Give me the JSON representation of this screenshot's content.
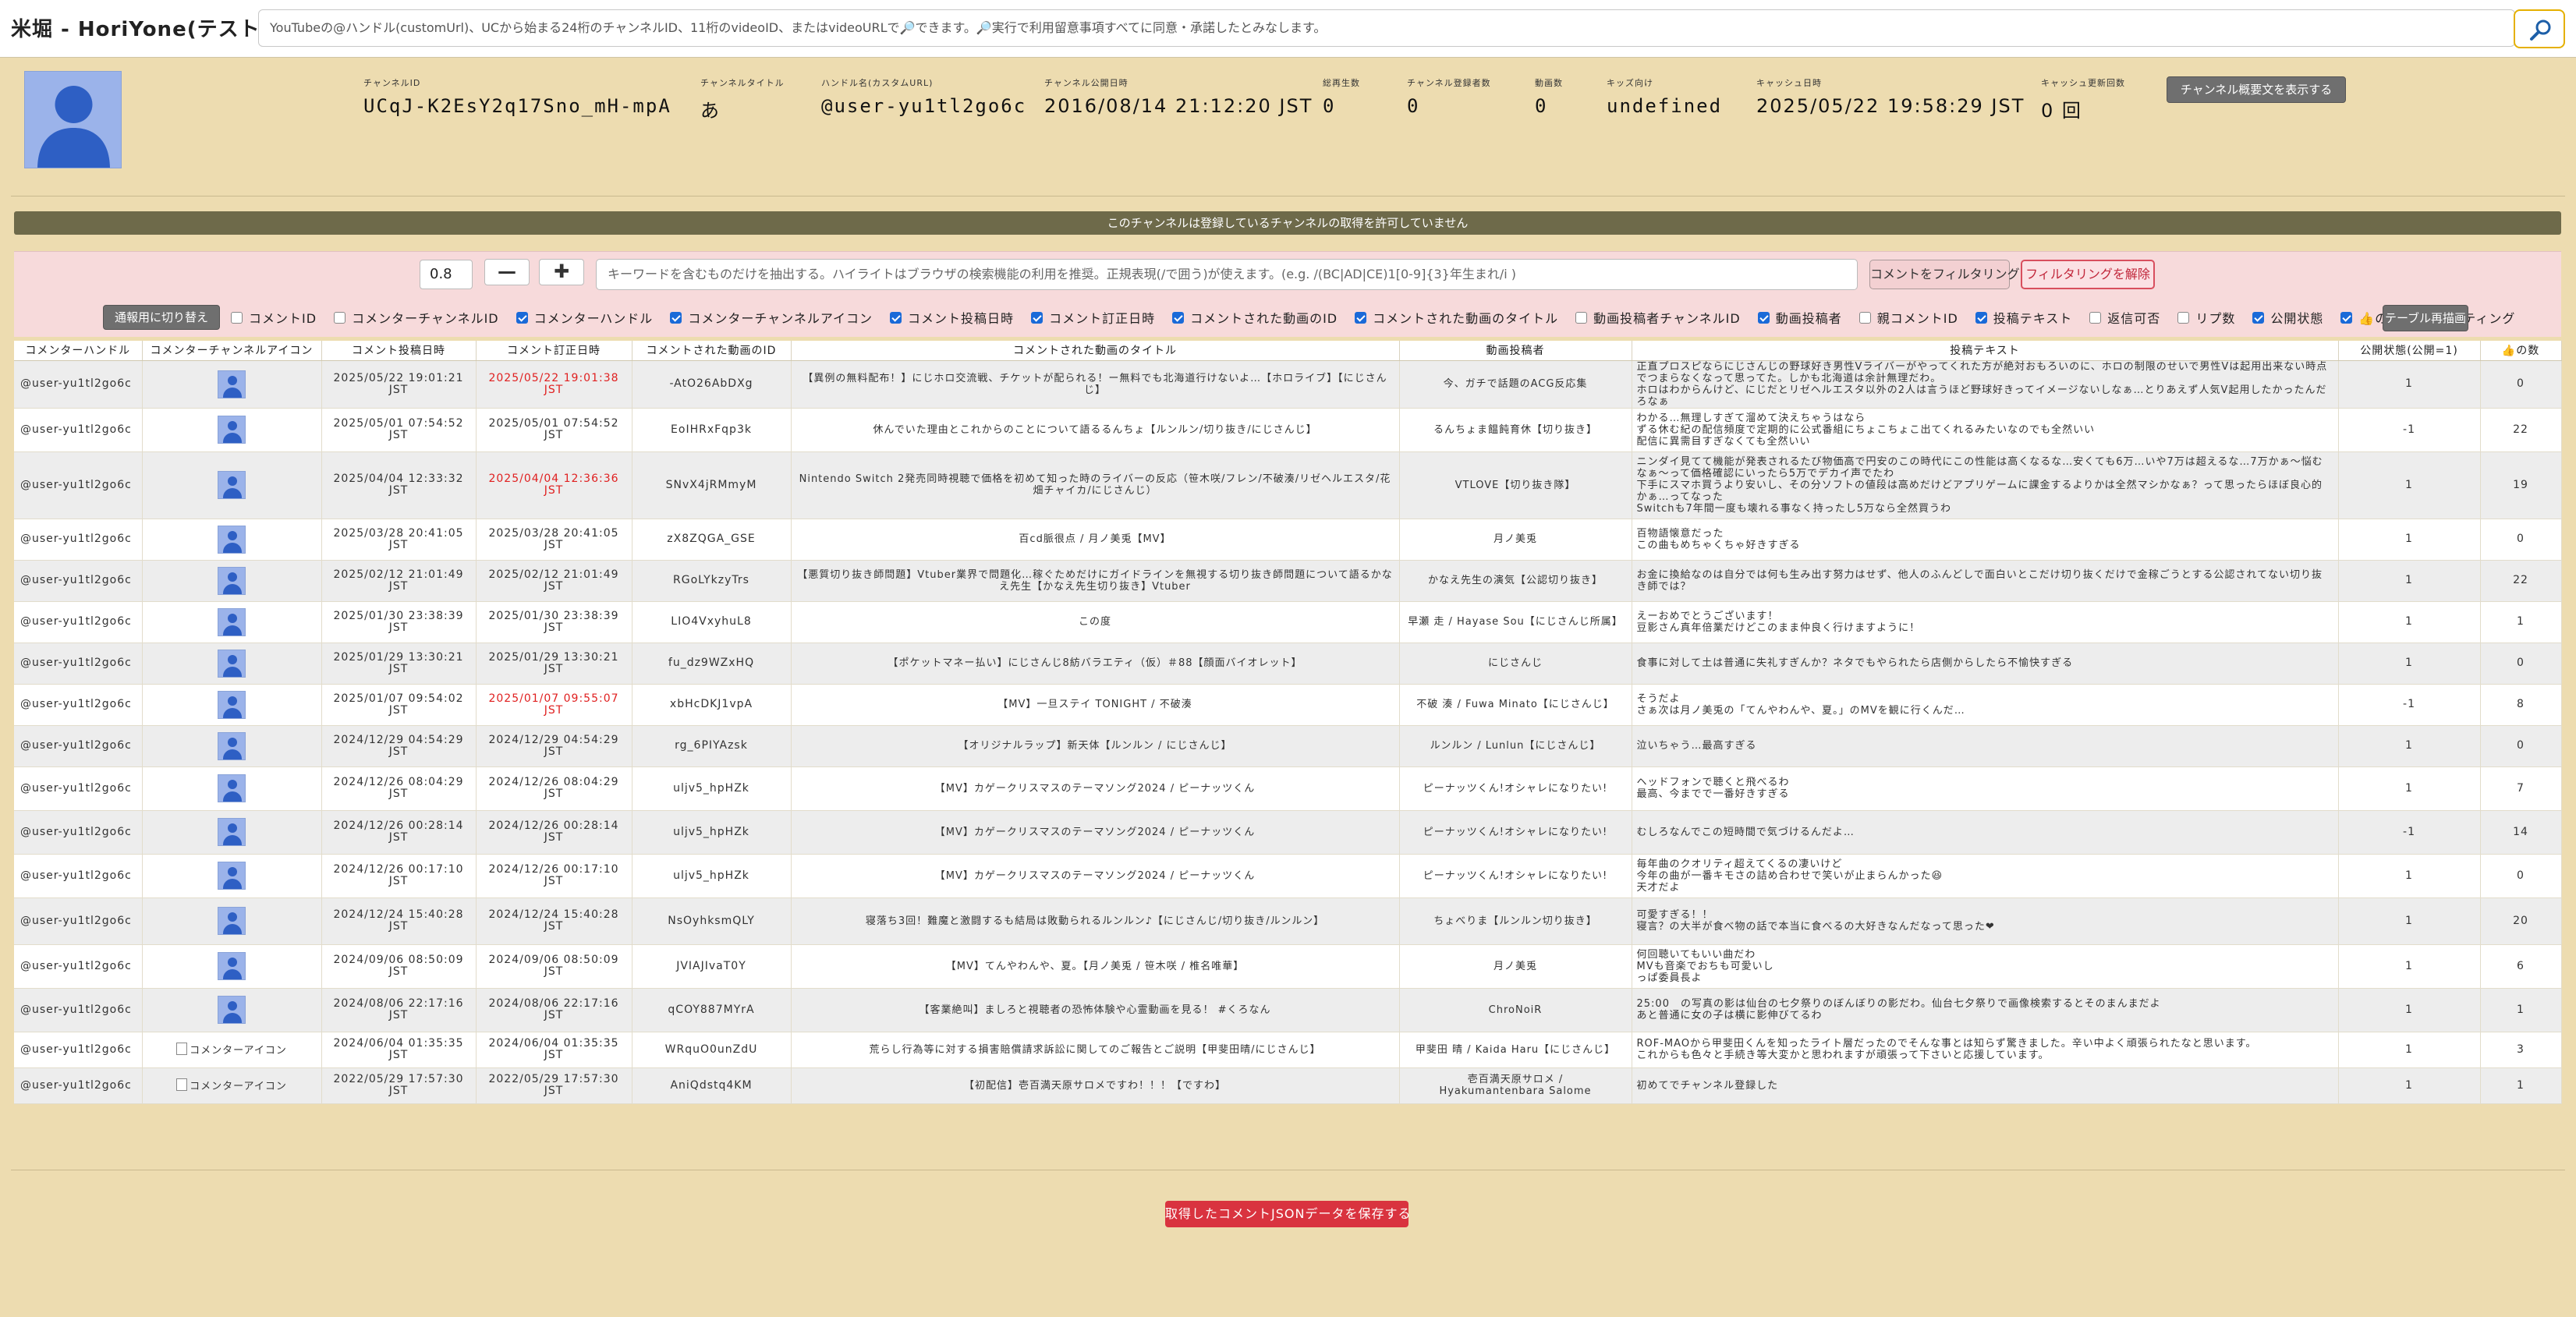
{
  "app": {
    "title": "米堀 - HoriYone(テスト中)",
    "search_placeholder": "YouTubeの@ハンドル(customUrl)、UCから始まる24桁のチャンネルID、11桁のvideoID、またはvideoURLで🔎できます。🔎実行で利用留意事項すべてに同意・承諾したとみなします。",
    "search_button_icon": "search-icon"
  },
  "channel": {
    "fields": [
      {
        "label": "チャンネルID",
        "value": "UCqJ-K2EsY2q17Sno_mH-mpA"
      },
      {
        "label": "チャンネルタイトル",
        "value": "あ"
      },
      {
        "label": "ハンドル名(カスタムURL)",
        "value": "@user-yu1tl2go6c"
      },
      {
        "label": "チャンネル公開日時",
        "value": "2016/08/14 21:12:20 JST"
      },
      {
        "label": "総再生数",
        "value": "0"
      },
      {
        "label": "チャンネル登録者数",
        "value": "0"
      },
      {
        "label": "動画数",
        "value": "0"
      },
      {
        "label": "キッズ向け",
        "value": "undefined"
      },
      {
        "label": "キャッシュ日時",
        "value": "2025/05/22 19:58:29 JST"
      },
      {
        "label": "キャッシュ更新回数",
        "value": "0 回"
      }
    ],
    "show_description_button": "チャンネル概要文を表示する",
    "notice": "このチャンネルは登録しているチャンネルの取得を許可していません"
  },
  "filter": {
    "threshold_value": "0.8",
    "minus_label": "—",
    "plus_label": "✚",
    "keyword_placeholder": "キーワードを含むものだけを抽出する。ハイライトはブラウザの検索機能の利用を推奨。正規表現(/で囲う)が使えます。(e.g. /(BC|AD|CE)1[0-9]{3}年生まれ/i )",
    "filter_button": "コメントをフィルタリング",
    "unfilter_button": "フィルタリングを解除",
    "toggle_view_button": "通報用に切り替え",
    "redraw_button": "テーブル再描画",
    "columns": [
      {
        "label": "コメントID",
        "checked": false
      },
      {
        "label": "コメンターチャンネルID",
        "checked": false
      },
      {
        "label": "コメンターハンドル",
        "checked": true
      },
      {
        "label": "コメンターチャンネルアイコン",
        "checked": true
      },
      {
        "label": "コメント投稿日時",
        "checked": true
      },
      {
        "label": "コメント訂正日時",
        "checked": true
      },
      {
        "label": "コメントされた動画のID",
        "checked": true
      },
      {
        "label": "コメントされた動画のタイトル",
        "checked": true
      },
      {
        "label": "動画投稿者チャンネルID",
        "checked": false
      },
      {
        "label": "動画投稿者",
        "checked": true
      },
      {
        "label": "親コメントID",
        "checked": false
      },
      {
        "label": "投稿テキスト",
        "checked": true
      },
      {
        "label": "返信可否",
        "checked": false
      },
      {
        "label": "リプ数",
        "checked": false
      },
      {
        "label": "公開状態",
        "checked": true
      },
      {
        "label": "👍の数",
        "checked": true
      },
      {
        "label": "レーティング",
        "checked": false
      }
    ]
  },
  "table": {
    "headers": [
      "コメンターハンドル",
      "コメンターチャンネルアイコン",
      "コメント投稿日時",
      "コメント訂正日時",
      "コメントされた動画のID",
      "コメントされた動画のタイトル",
      "動画投稿者",
      "投稿テキスト",
      "公開状態(公開=1)",
      "👍の数"
    ],
    "rows": [
      {
        "handle": "@user-yu1tl2go6c",
        "icon": "avatar",
        "posted": "2025/05/22 19:01:21\nJST",
        "edited": "2025/05/22 19:01:38\nJST",
        "edited_red": true,
        "video_id": "-AtO26AbDXg",
        "title": "【異例の無料配布！】にじホロ交流戦、チケットが配られる！ー無料でも北海道行けないよ…【ホロライブ】【にじさんじ】",
        "uploader": "今、ガチで話題のACG反応集",
        "text": "正直プロスピならにじさんじの野球好き男性Vライバーがやってくれた方が絶対おもろいのに、ホロの制限のせいで男性Vは起用出来ない時点でつまらなくなって思ってた。しかも北海道は余計無理だわ。\nホロはわからんけど、にじだとリゼヘルエスタ以外の2人は言うほど野球好きってイメージないしなぁ…とりあえず人気V起用したかったんだろなぁ",
        "status": "1",
        "likes": "0",
        "h": 56
      },
      {
        "handle": "@user-yu1tl2go6c",
        "icon": "avatar",
        "posted": "2025/05/01 07:54:52\nJST",
        "edited": "2025/05/01 07:54:52\nJST",
        "edited_red": false,
        "video_id": "EoIHRxFqp3k",
        "title": "休んでいた理由とこれからのことについて語るるんちょ【ルンルン/切り抜き/にじさんじ】",
        "uploader": "るんちょま饂飩育休【切り抜き】",
        "text": "わかる…無理しすぎて溜めて決えちゃうはなら\nずる休む紀の配信頻度で定期的に公式番組にちょこちょこ出てくれるみたいなのでも全然いい\n配信に異需目すぎなくても全然いい",
        "status": "-1",
        "likes": "22",
        "h": 56
      },
      {
        "handle": "@user-yu1tl2go6c",
        "icon": "avatar",
        "posted": "2025/04/04 12:33:32\nJST",
        "edited": "2025/04/04 12:36:36\nJST",
        "edited_red": true,
        "video_id": "SNvX4jRMmyM",
        "title": "Nintendo Switch 2発売同時視聴で価格を初めて知った時のライバーの反応（笹木咲/フレン/不破湊/リゼヘルエスタ/花畑チャイカ/にじさんじ）",
        "uploader": "VTLOVE【切り抜き隊】",
        "text": "ニンダイ見てて機能が発表されるたび物価高で円安のこの時代にこの性能は高くなるな…安くても6万…いや7万は超えるな…7万かぁ〜悩むなぁ〜って価格確認にいったら5万でデカイ声でたわ\n下手にスマホ買うより安いし、その分ソフトの値段は高めだけどアプリゲームに課金するよりかは全然マシかなぁ？って思ったらほぼ良心的かぁ…ってなった\nSwitchも7年間一度も壊れる事なく持ったし5万なら全然買うわ",
        "status": "1",
        "likes": "19",
        "h": 86
      },
      {
        "handle": "@user-yu1tl2go6c",
        "icon": "avatar",
        "posted": "2025/03/28 20:41:05\nJST",
        "edited": "2025/03/28 20:41:05\nJST",
        "edited_red": false,
        "video_id": "zX8ZQGA_GSE",
        "title": "百cd脈很点 / 月ノ美兎【MV】",
        "uploader": "月ノ美兎",
        "text": "百物語懐意だった\nこの曲もめちゃくちゃ好きすぎる",
        "status": "1",
        "likes": "0",
        "h": 53
      },
      {
        "handle": "@user-yu1tl2go6c",
        "icon": "avatar",
        "posted": "2025/02/12 21:01:49\nJST",
        "edited": "2025/02/12 21:01:49\nJST",
        "edited_red": false,
        "video_id": "RGoLYkzyTrs",
        "title": "【悪質切り抜き師問題】Vtuber業界で問題化…稼ぐためだけにガイドラインを無視する切り抜き師問題について語るかなえ先生【かなえ先生切り抜き】Vtuber",
        "uploader": "かなえ先生の演気【公認切り抜き】",
        "text": "お金に換給なのは自分では何も生み出す努力はせず、他人のふんどしで面白いとこだけ切り抜くだけで金稼ごうとする公認されてない切り抜き師では？",
        "status": "1",
        "likes": "22",
        "h": 53
      },
      {
        "handle": "@user-yu1tl2go6c",
        "icon": "avatar",
        "posted": "2025/01/30 23:38:39\nJST",
        "edited": "2025/01/30 23:38:39\nJST",
        "edited_red": false,
        "video_id": "LIO4VxyhuL8",
        "title": "この度",
        "uploader": "早瀬 走 / Hayase Sou【にじさんじ所属】",
        "text": "えーおめでとうございます！\n豆影さん真年倍業だけどこのまま仲良く行けますように！",
        "status": "1",
        "likes": "1",
        "h": 53
      },
      {
        "handle": "@user-yu1tl2go6c",
        "icon": "avatar",
        "posted": "2025/01/29 13:30:21\nJST",
        "edited": "2025/01/29 13:30:21\nJST",
        "edited_red": false,
        "video_id": "fu_dz9WZxHQ",
        "title": "【ポケットマネー払い】にじさんじ8紡バラエティ（仮）＃88【顔面バイオレット】",
        "uploader": "にじさんじ",
        "text": "食事に対して土は普通に失礼すぎんか？ネタでもやられたら店側からしたら不愉快すぎる",
        "status": "1",
        "likes": "0",
        "h": 53
      },
      {
        "handle": "@user-yu1tl2go6c",
        "icon": "avatar",
        "posted": "2025/01/07 09:54:02\nJST",
        "edited": "2025/01/07 09:55:07\nJST",
        "edited_red": true,
        "video_id": "xbHcDKJ1vpA",
        "title": "【MV】一旦ステイ TONIGHT / 不破湊",
        "uploader": "不破 湊 / Fuwa Minato【にじさんじ】",
        "text": "そうだよ\nさぁ次は月ノ美兎の「てんやわんや、夏。」のMVを観に行くんだ…",
        "status": "-1",
        "likes": "8",
        "h": 53
      },
      {
        "handle": "@user-yu1tl2go6c",
        "icon": "avatar",
        "posted": "2024/12/29 04:54:29\nJST",
        "edited": "2024/12/29 04:54:29\nJST",
        "edited_red": false,
        "video_id": "rg_6PIYAzsk",
        "title": "【オリジナルラップ】新天体【ルンルン / にじさんじ】",
        "uploader": "ルンルン / Lunlun【にじさんじ】",
        "text": "泣いちゃう…最高すぎる",
        "status": "1",
        "likes": "0",
        "h": 53
      },
      {
        "handle": "@user-yu1tl2go6c",
        "icon": "avatar",
        "posted": "2024/12/26 08:04:29\nJST",
        "edited": "2024/12/26 08:04:29\nJST",
        "edited_red": false,
        "video_id": "uljv5_hpHZk",
        "title": "【MV】カゲークリスマスのテーマソング2024 / ピーナッツくん",
        "uploader": "ピーナッツくん!オシャレになりたい!",
        "text": "ヘッドフォンで聴くと飛べるわ\n最高、今までで一番好きすぎる",
        "status": "1",
        "likes": "7",
        "h": 56
      },
      {
        "handle": "@user-yu1tl2go6c",
        "icon": "avatar",
        "posted": "2024/12/26 00:28:14\nJST",
        "edited": "2024/12/26 00:28:14\nJST",
        "edited_red": false,
        "video_id": "uljv5_hpHZk",
        "title": "【MV】カゲークリスマスのテーマソング2024 / ピーナッツくん",
        "uploader": "ピーナッツくん!オシャレになりたい!",
        "text": "むしろなんでこの短時間で気づけるんだよ…",
        "status": "-1",
        "likes": "14",
        "h": 56
      },
      {
        "handle": "@user-yu1tl2go6c",
        "icon": "avatar",
        "posted": "2024/12/26 00:17:10\nJST",
        "edited": "2024/12/26 00:17:10\nJST",
        "edited_red": false,
        "video_id": "uljv5_hpHZk",
        "title": "【MV】カゲークリスマスのテーマソング2024 / ピーナッツくん",
        "uploader": "ピーナッツくん!オシャレになりたい!",
        "text": "毎年曲のクオリティ超えてくるの凄いけど\n今年の曲が一番キモさの詰め合わせで笑いが止まらんかった😆\n天才だよ",
        "status": "1",
        "likes": "0",
        "h": 56
      },
      {
        "handle": "@user-yu1tl2go6c",
        "icon": "avatar",
        "posted": "2024/12/24 15:40:28\nJST",
        "edited": "2024/12/24 15:40:28\nJST",
        "edited_red": false,
        "video_id": "NsOyhksmQLY",
        "title": "寝落ち3回！難魔と激闘するも結局は敗動られるルンルン♪【にじさんじ/切り抜き/ルンルン】",
        "uploader": "ちょべりま【ルンルン切り抜き】",
        "text": "可愛すぎる！！\n寝言？の大半が食べ物の話で本当に食べるの大好きなんだなって思った❤",
        "status": "1",
        "likes": "20",
        "h": 60
      },
      {
        "handle": "@user-yu1tl2go6c",
        "icon": "avatar",
        "posted": "2024/09/06 08:50:09\nJST",
        "edited": "2024/09/06 08:50:09\nJST",
        "edited_red": false,
        "video_id": "JVIAJIvaT0Y",
        "title": "【MV】てんやわんや、夏。【月ノ美兎 / 笹木咲 / 椎名唯華】",
        "uploader": "月ノ美兎",
        "text": "何回聴いてもいい曲だわ\nMVも音楽でおちも可愛いし\nっぱ委員長よ",
        "status": "1",
        "likes": "6",
        "h": 56
      },
      {
        "handle": "@user-yu1tl2go6c",
        "icon": "avatar",
        "posted": "2024/08/06 22:17:16\nJST",
        "edited": "2024/08/06 22:17:16\nJST",
        "edited_red": false,
        "video_id": "qCOY887MYrA",
        "title": "【客業絶叫】ましろと視聴者の恐怖体験や心霊動画を見る！ #くろなん",
        "uploader": "ChroNoiR",
        "text": "25:00　の写真の影は仙台の七夕祭りのぼんぼりの影だわ。仙台七夕祭りで画像検索するとそのまんまだよ\nあと普通に女の子は横に影伸びてるわ",
        "status": "1",
        "likes": "1",
        "h": 56
      },
      {
        "handle": "@user-yu1tl2go6c",
        "icon": "broken",
        "icon_alt": "コメンターアイコン",
        "posted": "2024/06/04 01:35:35\nJST",
        "edited": "2024/06/04 01:35:35\nJST",
        "edited_red": false,
        "video_id": "WRquO0unZdU",
        "title": "荒らし行為等に対する損害賠償請求訴訟に関してのご報告とご説明【甲斐田晴/にじさんじ】",
        "uploader": "甲斐田 晴 / Kaida Haru【にじさんじ】",
        "text": "ROF-MAOから甲斐田くんを知ったライト層だったのでそんな事とは知らず驚きました。辛い中よく頑張られたなと思います。\nこれからも色々と手続き等大変かと思われますが頑張って下さいと応援しています。",
        "status": "1",
        "likes": "3",
        "h": 46
      },
      {
        "handle": "@user-yu1tl2go6c",
        "icon": "broken",
        "icon_alt": "コメンターアイコン",
        "posted": "2022/05/29 17:57:30\nJST",
        "edited": "2022/05/29 17:57:30\nJST",
        "edited_red": false,
        "video_id": "AniQdstq4KM",
        "title": "【初配信】壱百満天原サロメですわ！！！【ですわ】",
        "uploader": "壱百満天原サロメ /\nHyakumantenbara Salome",
        "text": "初めてでチャンネル登録した",
        "status": "1",
        "likes": "1",
        "h": 46
      }
    ]
  },
  "save_button": "取得したコメントJSONデータを保存する",
  "colors": {
    "background": "#eddcb0",
    "accent_red": "#d9333f",
    "checkbox_blue": "#1a6ad8",
    "avatar_blue": "#2e5fc4"
  }
}
